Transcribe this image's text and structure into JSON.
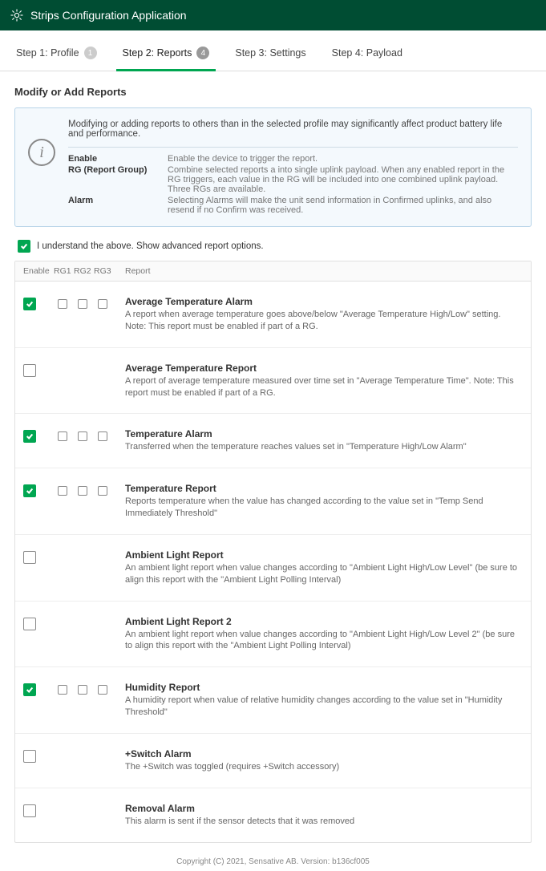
{
  "header": {
    "title": "Strips Configuration Application"
  },
  "stepper": [
    {
      "label": "Step 1: Profile",
      "badge": "1"
    },
    {
      "label": "Step 2: Reports",
      "badge": "4"
    },
    {
      "label": "Step 3: Settings",
      "badge": ""
    },
    {
      "label": "Step 4: Payload",
      "badge": ""
    }
  ],
  "section_title": "Modify or Add Reports",
  "info": {
    "lead": "Modifying or adding reports to others than in the selected profile may significantly affect product battery life and performance.",
    "defs": [
      {
        "term": "Enable",
        "def": "Enable the device to trigger the report."
      },
      {
        "term": "RG (Report Group)",
        "def": "Combine selected reports a into single uplink payload. When any enabled report in the RG triggers, each value in the RG will be included into one combined uplink payload. Three RGs are available."
      },
      {
        "term": "Alarm",
        "def": "Selecting Alarms will make the unit send information in Confirmed uplinks, and also resend if no Confirm was received."
      }
    ]
  },
  "consent": {
    "checked": true,
    "label": "I understand the above. Show advanced report options."
  },
  "columns": {
    "enable": "Enable",
    "rg1": "RG1",
    "rg2": "RG2",
    "rg3": "RG3",
    "report": "Report"
  },
  "reports": [
    {
      "enabled": true,
      "show_rg": true,
      "title": "Average Temperature Alarm",
      "desc": "A report when average temperature goes above/below \"Average Temperature High/Low\" setting. Note: This report must be enabled if part of a RG."
    },
    {
      "enabled": false,
      "show_rg": false,
      "title": "Average Temperature Report",
      "desc": "A report of average temperature measured over time set in \"Average Temperature Time\". Note: This report must be enabled if part of a RG."
    },
    {
      "enabled": true,
      "show_rg": true,
      "title": "Temperature Alarm",
      "desc": "Transferred when the temperature reaches values set in \"Temperature High/Low Alarm\""
    },
    {
      "enabled": true,
      "show_rg": true,
      "title": "Temperature Report",
      "desc": "Reports temperature when the value has changed according to the value set in \"Temp Send Immediately Threshold\""
    },
    {
      "enabled": false,
      "show_rg": false,
      "title": "Ambient Light Report",
      "desc": "An ambient light report when value changes according to \"Ambient Light High/Low Level\" (be sure to align this report with the \"Ambient Light Polling Interval)"
    },
    {
      "enabled": false,
      "show_rg": false,
      "title": "Ambient Light Report 2",
      "desc": "An ambient light report when value changes according to \"Ambient Light High/Low Level 2\" (be sure to align this report with the \"Ambient Light Polling Interval)"
    },
    {
      "enabled": true,
      "show_rg": true,
      "title": "Humidity Report",
      "desc": "A humidity report when value of relative humidity changes according to the value set in \"Humidity Threshold\""
    },
    {
      "enabled": false,
      "show_rg": false,
      "title": "+Switch Alarm",
      "desc": "The +Switch was toggled (requires +Switch accessory)"
    },
    {
      "enabled": false,
      "show_rg": false,
      "title": "Removal Alarm",
      "desc": "This alarm is sent if the sensor detects that it was removed"
    }
  ],
  "footer": "Copyright (C) 2021, Sensative AB. Version: b136cf005"
}
